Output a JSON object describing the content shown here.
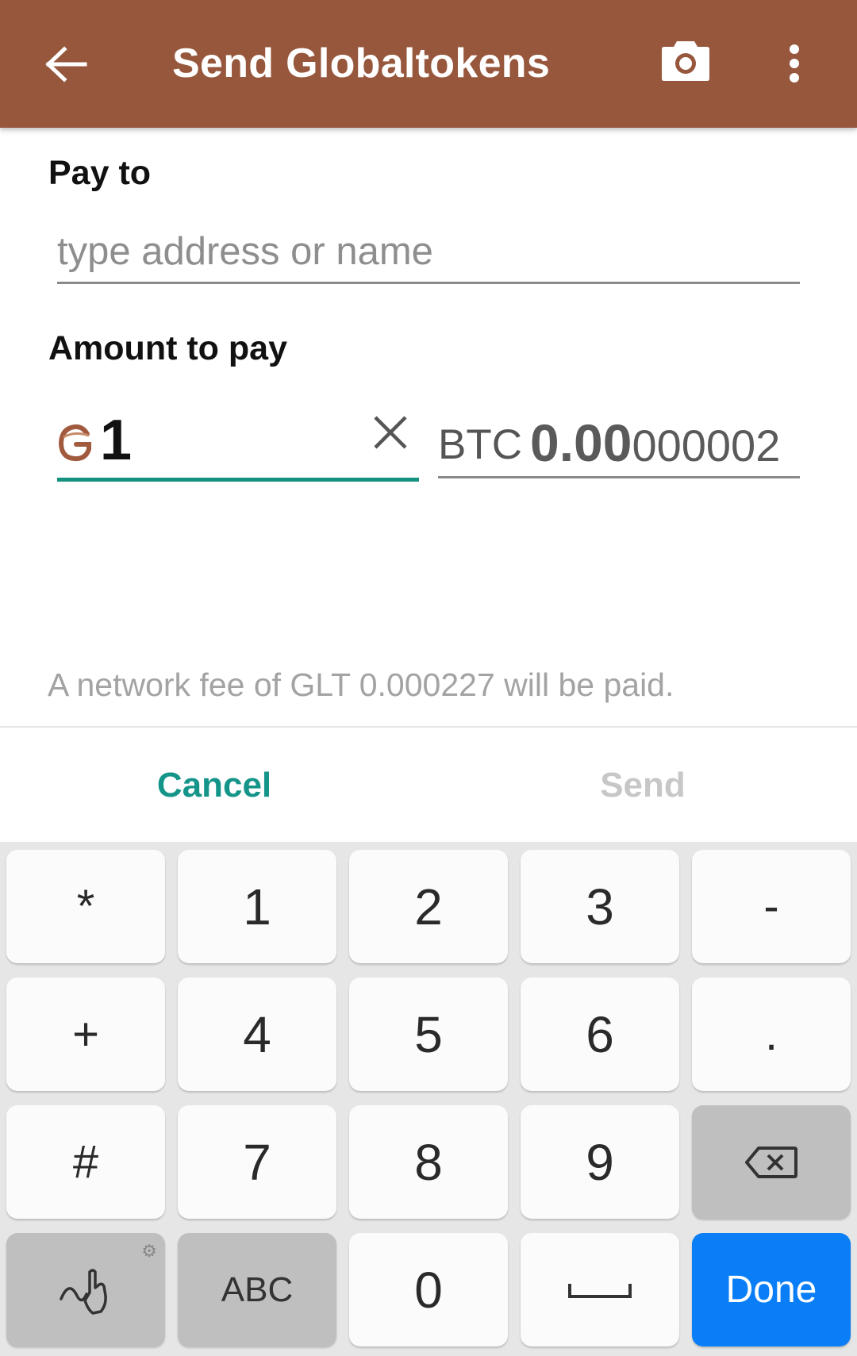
{
  "appbar": {
    "title": "Send Globaltokens",
    "back_icon": "arrow-back-icon",
    "camera_icon": "camera-icon",
    "more_icon": "more-vert-icon",
    "color": "#97573d"
  },
  "form": {
    "pay_to_label": "Pay to",
    "address_placeholder": "type address or name",
    "address_value": "",
    "amount_label": "Amount to pay",
    "glt_amount": "1",
    "btc_code": "BTC",
    "btc_amount_main": "0.00",
    "btc_amount_rest": "000002",
    "fee_text": "A network fee of GLT 0.000227 will be paid.",
    "accent_color": "#14917f"
  },
  "actions": {
    "cancel_label": "Cancel",
    "send_label": "Send"
  },
  "keyboard": {
    "rows": [
      [
        "*",
        "1",
        "2",
        "3",
        "-"
      ],
      [
        "+",
        "4",
        "5",
        "6",
        "."
      ],
      [
        "#",
        "7",
        "8",
        "9",
        "backspace-icon"
      ],
      [
        "handwriting-icon",
        "ABC",
        "0",
        "space-icon",
        "Done"
      ]
    ],
    "done_label": "Done",
    "abc_label": "ABC",
    "done_color": "#0a7ef6"
  }
}
